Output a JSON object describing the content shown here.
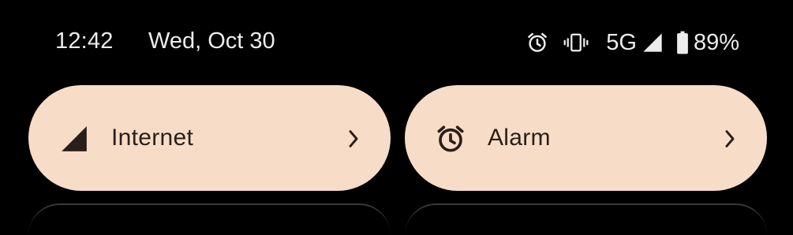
{
  "status_bar": {
    "time": "12:42",
    "date": "Wed, Oct 30",
    "network_type": "5G",
    "battery_percent": "89%",
    "icons": [
      "alarm-icon",
      "vibrate-icon",
      "signal-icon",
      "battery-icon"
    ]
  },
  "tiles": [
    {
      "label": "Internet",
      "icon": "signal-icon",
      "chevron": "chevron-right-icon"
    },
    {
      "label": "Alarm",
      "icon": "alarm-icon",
      "chevron": "chevron-right-icon"
    }
  ],
  "colors": {
    "background": "#000000",
    "tile_bg": "#f7dcc8",
    "tile_text": "#2a1f18",
    "status_text": "#ececec"
  }
}
